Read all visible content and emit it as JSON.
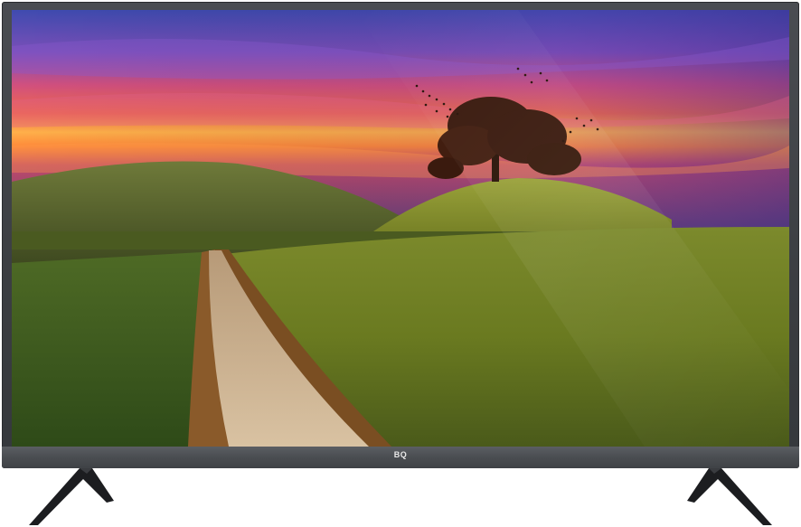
{
  "product": {
    "brand_logo_text": "BQ"
  },
  "colors": {
    "bezel": "#3b3e42",
    "stand": "#1c1d20",
    "sky_top": "#4a4fb0",
    "sky_sunset": "#ff7a2a",
    "grass": "#7a8a2a"
  },
  "screen": {
    "content_description_icon": "landscape-wallpaper-image"
  }
}
